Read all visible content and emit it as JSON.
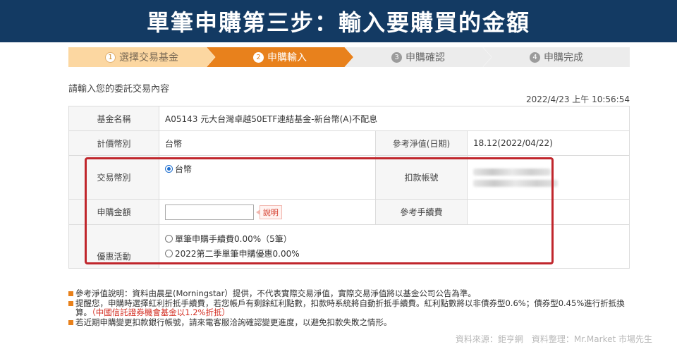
{
  "banner": {
    "title": "單筆申購第三步：輸入要購買的金額"
  },
  "steps": [
    {
      "num": "1",
      "label": "選擇交易基金"
    },
    {
      "num": "2",
      "label": "申購輸入"
    },
    {
      "num": "3",
      "label": "申購確認"
    },
    {
      "num": "4",
      "label": "申購完成"
    }
  ],
  "instruction": "請輸入您的委託交易內容",
  "timestamp": "2022/4/23 上午 10:56:54",
  "form": {
    "fund_name_label": "基金名稱",
    "fund_name": "A05143 元大台灣卓越50ETF連結基金-新台幣(A)不配息",
    "currency_label": "計價幣別",
    "currency": "台幣",
    "nav_label": "參考淨值(日期)",
    "nav": "18.12(2022/04/22)",
    "trade_currency_label": "交易幣別",
    "trade_currency": "台幣",
    "debit_account_label": "扣款帳號",
    "amount_label": "申購金額",
    "amount_value": "",
    "explain_label": "說明",
    "fee_label": "參考手續費",
    "promo_label": "優惠活動",
    "promo_options": [
      "單筆申購手續費0.00%（5筆）",
      "2022第二季單筆申購優惠0.00%"
    ]
  },
  "notes": [
    {
      "text": "參考淨值說明：資料由晨星(Morningstar）提供，不代表實際交易淨值，實際交易淨值將以基金公司公告為準。"
    },
    {
      "text": "提醒您，申購時選擇紅利折抵手續費，若您帳戶有剩餘紅利點數，扣款時系統將自動折抵手續費。紅利點數將以非債券型0.6%；債券型0.45%進行折抵換算。",
      "highlight": "（中國信託證券機會基金以1.2%折抵）"
    },
    {
      "text": "若近期申購變更扣款銀行帳號，請來電客服洽詢確認變更進度，以避免扣款失敗之情形。"
    }
  ],
  "credit": "資料來源：鉅亨網　資料整理：Mr.Market 市場先生",
  "colors": {
    "banner": "#133a63",
    "active_step": "#e8811c",
    "highlight_box": "#c0262c"
  }
}
